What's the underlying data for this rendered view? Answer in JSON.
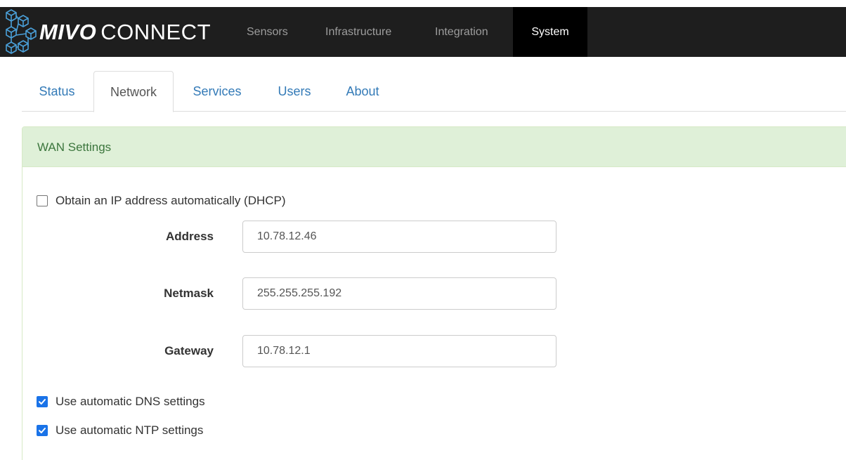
{
  "brand": {
    "name_bold": "MIVO",
    "name_rest": "CONNECT"
  },
  "nav": {
    "items": [
      {
        "label": "Sensors",
        "active": false
      },
      {
        "label": "Infrastructure",
        "active": false
      },
      {
        "label": "Integration",
        "active": false
      },
      {
        "label": "System",
        "active": true
      }
    ]
  },
  "tabs": [
    {
      "label": "Status",
      "active": false
    },
    {
      "label": "Network",
      "active": true
    },
    {
      "label": "Services",
      "active": false
    },
    {
      "label": "Users",
      "active": false
    },
    {
      "label": "About",
      "active": false
    }
  ],
  "wan": {
    "heading": "WAN Settings",
    "dhcp": {
      "label": "Obtain an IP address automatically (DHCP)",
      "checked": false
    },
    "fields": {
      "address": {
        "label": "Address",
        "value": "10.78.12.46"
      },
      "netmask": {
        "label": "Netmask",
        "value": "255.255.255.192"
      },
      "gateway": {
        "label": "Gateway",
        "value": "10.78.12.1"
      }
    },
    "dns": {
      "label": "Use automatic DNS settings",
      "checked": true
    },
    "ntp": {
      "label": "Use automatic NTP settings",
      "checked": true
    }
  },
  "colors": {
    "navbar_bg": "#1e1e1e",
    "nav_active_bg": "#000000",
    "link_blue": "#337ab7",
    "panel_heading_bg": "#dff0d8",
    "panel_heading_text": "#3c763d",
    "checkbox_checked": "#1a73e8"
  },
  "icons": {
    "logo": "network-cubes-logo-icon",
    "checkmark": "checkmark-icon"
  }
}
